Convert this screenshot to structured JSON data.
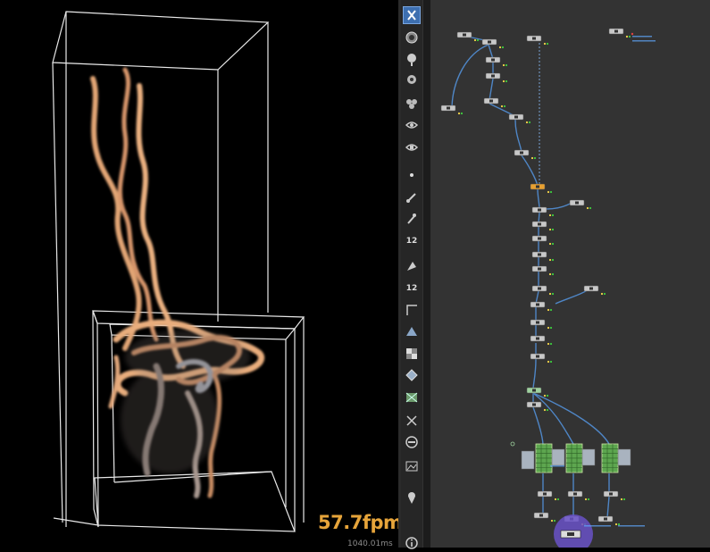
{
  "viewport": {
    "fps": "57.7fpm",
    "frame_time": "1040.01ms"
  },
  "toolbar": {
    "tools": [
      {
        "name": "select-tool",
        "glyph": "select"
      },
      {
        "name": "view-tool",
        "glyph": "view"
      },
      {
        "name": "handle-tool",
        "glyph": "handle"
      },
      {
        "name": "pose-tool",
        "glyph": "pose"
      },
      {
        "name": "render-region-tool",
        "glyph": "region"
      },
      {
        "name": "camera-tool",
        "glyph": "camera"
      },
      {
        "name": "flipbook-tool",
        "glyph": "flipbook"
      },
      {
        "name": "point-tool",
        "glyph": "point"
      },
      {
        "name": "brush-tool",
        "glyph": "brush"
      },
      {
        "name": "pin-tool",
        "glyph": "pin"
      },
      {
        "name": "display-count-tool",
        "glyph": "12",
        "label": "12"
      },
      {
        "name": "paint-tool",
        "glyph": "paint"
      },
      {
        "name": "display-count-2-tool",
        "glyph": "12",
        "label": "12"
      },
      {
        "name": "corner-tool",
        "glyph": "corner"
      },
      {
        "name": "shading-tool",
        "glyph": "shade"
      },
      {
        "name": "texture-tool",
        "glyph": "checker"
      },
      {
        "name": "wireframe-tool",
        "glyph": "wire"
      },
      {
        "name": "uv-tool",
        "glyph": "uv"
      },
      {
        "name": "snap-tool",
        "glyph": "snap"
      },
      {
        "name": "ghost-tool",
        "glyph": "ghost"
      },
      {
        "name": "background-tool",
        "glyph": "bg"
      },
      {
        "name": "location-tool",
        "glyph": "location"
      },
      {
        "name": "info-tool",
        "glyph": "info"
      }
    ]
  }
}
